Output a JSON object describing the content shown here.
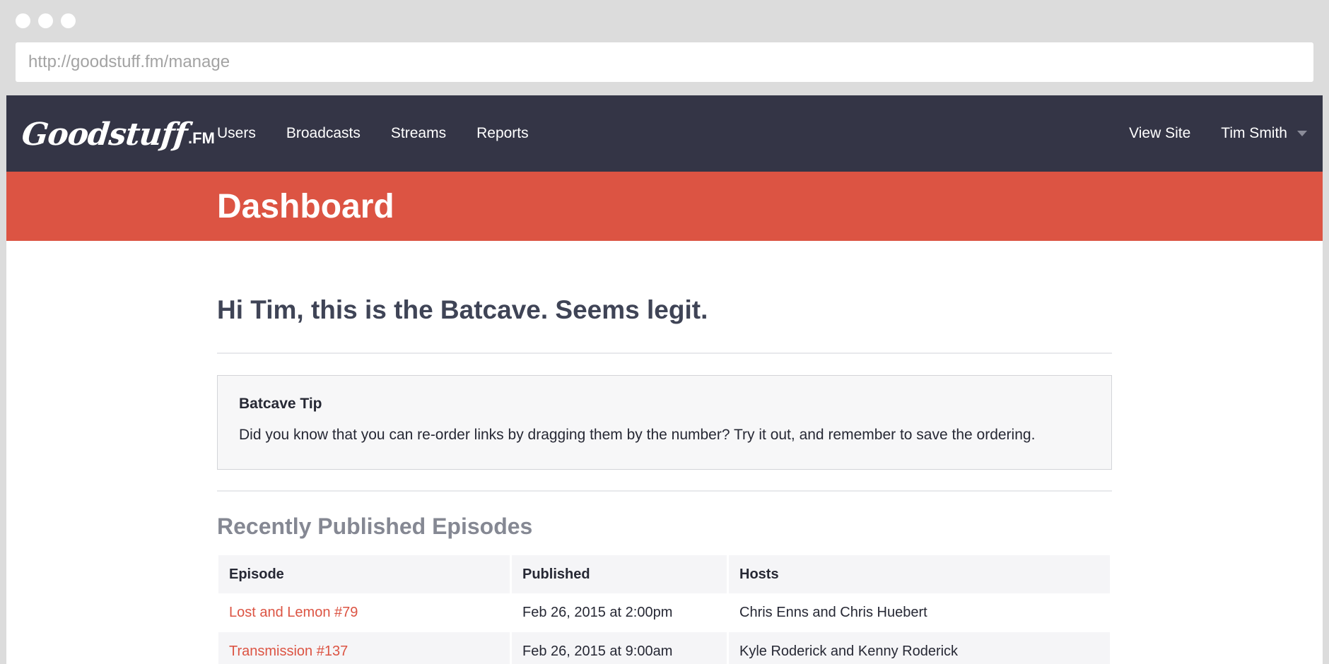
{
  "browser": {
    "url": "http://goodstuff.fm/manage"
  },
  "nav": {
    "logo_text": "Goodstuff",
    "logo_suffix": ".FM",
    "links": [
      "Users",
      "Broadcasts",
      "Streams",
      "Reports"
    ],
    "view_site": "View Site",
    "user_name": "Tim Smith"
  },
  "header": {
    "title": "Dashboard"
  },
  "main": {
    "greeting": "Hi Tim, this is the Batcave. Seems legit.",
    "tip": {
      "title": "Batcave Tip",
      "text": "Did you know that you can re-order links by dragging them by the number? Try it out, and remember to save the ordering."
    },
    "episodes": {
      "title": "Recently Published Episodes",
      "columns": [
        "Episode",
        "Published",
        "Hosts"
      ],
      "rows": [
        {
          "episode": "Lost and Lemon #79",
          "published": "Feb 26, 2015 at 2:00pm",
          "hosts": "Chris Enns and Chris Huebert"
        },
        {
          "episode": "Transmission #137",
          "published": "Feb 26, 2015 at 9:00am",
          "hosts": "Kyle Roderick and Kenny Roderick"
        }
      ]
    }
  },
  "colors": {
    "nav_bg": "#343546",
    "accent_red": "#dc5443",
    "heading_text": "#3f4456"
  }
}
